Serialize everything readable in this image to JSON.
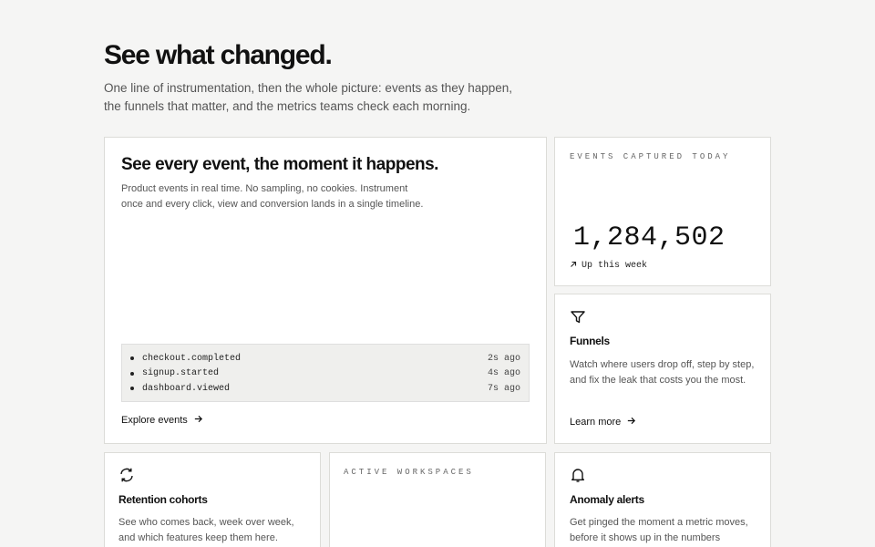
{
  "hero": {
    "title": "See what changed.",
    "subtitle": "One line of instrumentation, then the whole picture: events as they happen, the funnels that matter, and the metrics teams check each morning."
  },
  "events_card": {
    "title": "See every event, the moment it happens.",
    "description": "Product events in real time. No sampling, no cookies. Instrument once and every click, view and conversion lands in a single timeline.",
    "feed": [
      {
        "name": "checkout.completed",
        "time": "2s ago"
      },
      {
        "name": "signup.started",
        "time": "4s ago"
      },
      {
        "name": "dashboard.viewed",
        "time": "7s ago"
      }
    ],
    "link_label": "Explore events",
    "link_icon": "arrow-right-icon"
  },
  "stat_events": {
    "caption": "EVENTS CAPTURED TODAY",
    "value": "1,284,502",
    "trend": "Up this week",
    "trend_icon": "arrow-up-right-icon"
  },
  "funnels": {
    "icon": "funnel-icon",
    "title": "Funnels",
    "description": "Watch where users drop off, step by step, and fix the leak that costs you the most.",
    "link_label": "Learn more",
    "link_icon": "arrow-right-icon"
  },
  "retention": {
    "icon": "refresh-icon",
    "title": "Retention cohorts",
    "description": "See who comes back, week over week, and which features keep them here."
  },
  "stat_workspaces": {
    "caption": "ACTIVE WORKSPACES"
  },
  "alerts": {
    "icon": "bell-icon",
    "title": "Anomaly alerts",
    "description": "Get pinged the moment a metric moves, before it shows up in the numbers"
  }
}
